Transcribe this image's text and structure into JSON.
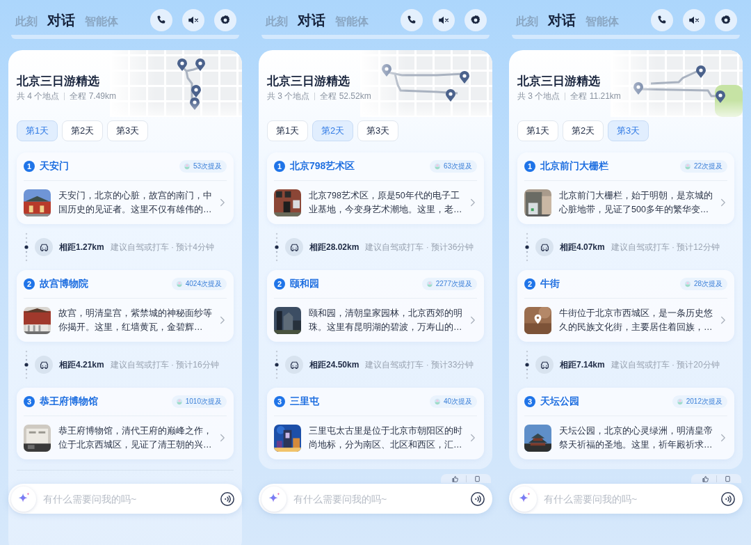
{
  "panels": [
    {
      "tabs": [
        {
          "label": "此刻",
          "selected": false
        },
        {
          "label": "对话",
          "selected": true
        },
        {
          "label": "智能体",
          "selected": false
        }
      ],
      "card": {
        "title": "北京三日游精选",
        "stop_count": "共 4 个地点",
        "distance": "全程 7.49km",
        "day_tabs": [
          {
            "label": "第1天",
            "selected": true
          },
          {
            "label": "第2天",
            "selected": false
          },
          {
            "label": "第3天",
            "selected": false
          }
        ],
        "stops": [
          {
            "number": "1",
            "name": "天安门",
            "mentions": "53次提及",
            "description": "天安门，北京的心脏，故宫的南门，中国历史的见证者。这里不仅有雄伟的…",
            "next_leg": {
              "distance": "相距1.27km",
              "advice": "建议自驾或打车 · 预计4分钟"
            }
          },
          {
            "number": "2",
            "name": "故宫博物院",
            "mentions": "4024次提及",
            "description": "故宫，明清皇宫，紫禁城的神秘面纱等你揭开。这里，红墙黄瓦，金碧辉…",
            "next_leg": {
              "distance": "相距4.21km",
              "advice": "建议自驾或打车 · 预计16分钟"
            }
          },
          {
            "number": "3",
            "name": "恭王府博物馆",
            "mentions": "1010次提及",
            "description": "恭王府博物馆，清代王府的巅峰之作，位于北京西城区，见证了清王朝的兴…"
          }
        ]
      },
      "feedback_bar": false,
      "input": {
        "placeholder": "有什么需要问我的吗~"
      }
    },
    {
      "tabs": [
        {
          "label": "此刻",
          "selected": false
        },
        {
          "label": "对话",
          "selected": true
        },
        {
          "label": "智能体",
          "selected": false
        }
      ],
      "card": {
        "title": "北京三日游精选",
        "stop_count": "共 3 个地点",
        "distance": "全程 52.52km",
        "day_tabs": [
          {
            "label": "第1天",
            "selected": false
          },
          {
            "label": "第2天",
            "selected": true
          },
          {
            "label": "第3天",
            "selected": false
          }
        ],
        "stops": [
          {
            "number": "1",
            "name": "北京798艺术区",
            "mentions": "63次提及",
            "description": "北京798艺术区，原是50年代的电子工业基地，今变身艺术潮地。这里，老…",
            "next_leg": {
              "distance": "相距28.02km",
              "advice": "建议自驾或打车 · 预计36分钟"
            }
          },
          {
            "number": "2",
            "name": "颐和园",
            "mentions": "2277次提及",
            "description": "颐和园，清朝皇家园林，北京西郊的明珠。这里有昆明湖的碧波，万寿山的…",
            "next_leg": {
              "distance": "相距24.50km",
              "advice": "建议自驾或打车 · 预计33分钟"
            }
          },
          {
            "number": "3",
            "name": "三里屯",
            "mentions": "40次提及",
            "description": "三里屯太古里是位于北京市朝阳区的时尚地标，分为南区、北区和西区，汇…"
          }
        ]
      },
      "feedback_bar": true,
      "input": {
        "placeholder": "有什么需要问我的吗~"
      }
    },
    {
      "tabs": [
        {
          "label": "此刻",
          "selected": false
        },
        {
          "label": "对话",
          "selected": true
        },
        {
          "label": "智能体",
          "selected": false
        }
      ],
      "card": {
        "title": "北京三日游精选",
        "stop_count": "共 3 个地点",
        "distance": "全程 11.21km",
        "day_tabs": [
          {
            "label": "第1天",
            "selected": false
          },
          {
            "label": "第2天",
            "selected": false
          },
          {
            "label": "第3天",
            "selected": true
          }
        ],
        "stops": [
          {
            "number": "1",
            "name": "北京前门大栅栏",
            "mentions": "22次提及",
            "description": "北京前门大栅栏，始于明朝，是京城的心脏地带，见证了500多年的繁华变…",
            "next_leg": {
              "distance": "相距4.07km",
              "advice": "建议自驾或打车 · 预计12分钟"
            }
          },
          {
            "number": "2",
            "name": "牛街",
            "mentions": "28次提及",
            "description": "牛街位于北京市西城区，是一条历史悠久的民族文化街，主要居住着回族，…",
            "image": {
              "kind": "placeholder"
            },
            "next_leg": {
              "distance": "相距7.14km",
              "advice": "建议自驾或打车 · 预计20分钟"
            }
          },
          {
            "number": "3",
            "name": "天坛公园",
            "mentions": "2012次提及",
            "description": "天坛公园，北京的心灵绿洲，明清皇帝祭天祈福的圣地。这里，祈年殿祈求…"
          }
        ]
      },
      "feedback_bar": true,
      "input": {
        "placeholder": "有什么需要问我的吗~"
      }
    }
  ]
}
